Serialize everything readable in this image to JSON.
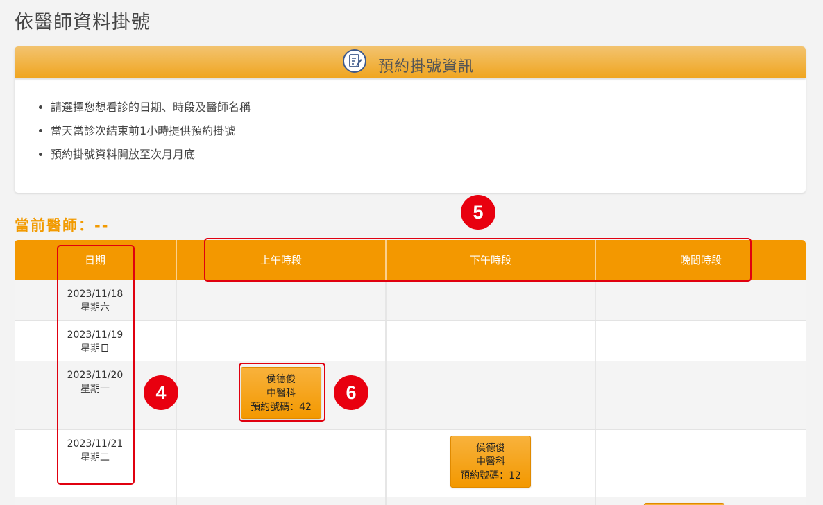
{
  "page": {
    "title": "依醫師資料掛號"
  },
  "info_panel": {
    "title": "預約掛號資訊",
    "icon": "edit-document-icon",
    "items": [
      "請選擇您想看診的日期、時段及醫師名稱",
      "當天當診次結束前1小時提供預約掛號",
      "預約掛號資料開放至次月月底"
    ]
  },
  "current_doctor": {
    "label": "當前醫師：--"
  },
  "schedule": {
    "headers": [
      "日期",
      "上午時段",
      "下午時段",
      "晚間時段"
    ],
    "rows": [
      {
        "date": "2023/11/18",
        "weekday": "星期六"
      },
      {
        "date": "2023/11/19",
        "weekday": "星期日"
      },
      {
        "date": "2023/11/20",
        "weekday": "星期一"
      },
      {
        "date": "2023/11/21",
        "weekday": "星期二"
      }
    ],
    "appointments": [
      {
        "doctor": "侯德俊",
        "department": "中醫科",
        "number": "預約號碼：42"
      },
      {
        "doctor": "侯德俊",
        "department": "中醫科",
        "number": "預約號碼：12"
      }
    ]
  },
  "annotations": [
    "4",
    "5",
    "6"
  ],
  "colors": {
    "accent": "#f39800",
    "annotation": "#e8000f"
  }
}
